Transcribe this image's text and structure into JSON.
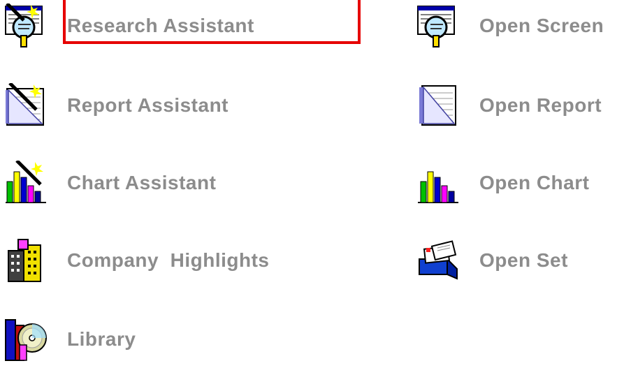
{
  "left_column": {
    "research_assistant": {
      "label": "Research Assistant",
      "icon": "research-magnifier-icon",
      "selected": true
    },
    "report_assistant": {
      "label": "Report Assistant",
      "icon": "report-wand-icon"
    },
    "chart_assistant": {
      "label": "Chart Assistant",
      "icon": "chart-wand-icon"
    },
    "company_highlights": {
      "label": "Company  Highlights",
      "icon": "buildings-icon"
    },
    "library": {
      "label": "Library",
      "icon": "books-cd-icon"
    }
  },
  "right_column": {
    "open_screen": {
      "label": "Open Screen",
      "icon": "screen-magnifier-icon"
    },
    "open_report": {
      "label": "Open Report",
      "icon": "report-document-icon"
    },
    "open_chart": {
      "label": "Open Chart",
      "icon": "bar-chart-icon"
    },
    "open_set": {
      "label": "Open Set",
      "icon": "card-file-icon"
    }
  },
  "colors": {
    "label_text": "#8c8c8c",
    "selection_border": "#e60000"
  }
}
